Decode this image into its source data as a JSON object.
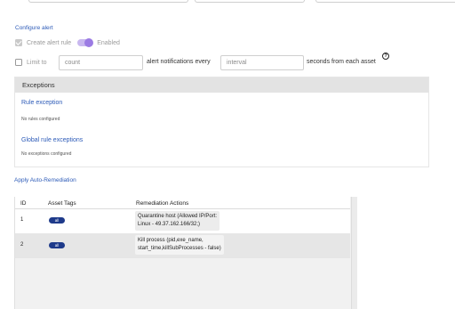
{
  "configure_alert": {
    "heading": "Configure alert",
    "create_rule_label": "Create alert rule",
    "create_rule_checked": true,
    "toggle_label": "Enabled",
    "toggle_on": true,
    "limit_label": "Limit to",
    "limit_checked": false,
    "count_placeholder": "count",
    "notifications_label": "alert notifications every",
    "interval_placeholder": "interval",
    "seconds_label": "seconds from each asset",
    "help_icon": "?"
  },
  "exceptions": {
    "header": "Exceptions",
    "rule_exception_title": "Rule exception",
    "rule_exception_note": "No rules configured",
    "global_exception_title": "Global rule exceptions",
    "global_exception_note": "No exceptions configured"
  },
  "remediation": {
    "heading": "Apply Auto-Remediation",
    "columns": [
      "ID",
      "Asset Tags",
      "Remediation Actions"
    ],
    "rows": [
      {
        "id": "1",
        "tag": "all",
        "action_line1": "Quarantine host (Allowed IP/Port:",
        "action_line2": "Linux - 49.37.162.166/32;)"
      },
      {
        "id": "2",
        "tag": "all",
        "action_line1": "Kill process (pid,exe_name,",
        "action_line2": "start_time,killSubProcesses - false)"
      }
    ]
  }
}
